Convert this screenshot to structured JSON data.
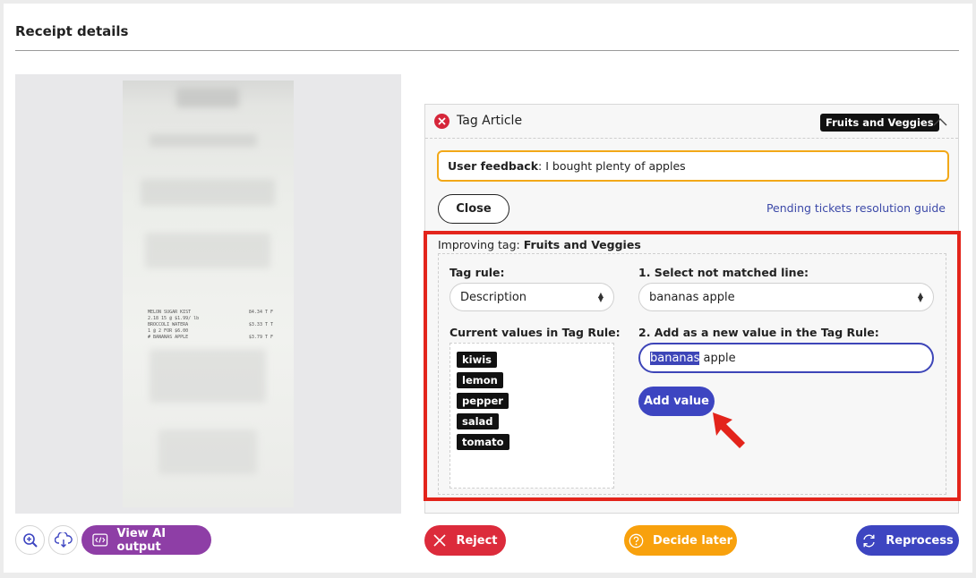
{
  "header": {
    "title": "Receipt details"
  },
  "receipt": {
    "lines": [
      [
        "MELON SUGAR KIST",
        "84.34 T F"
      ],
      [
        "2.18 15 @ $1.99/ lb",
        ""
      ],
      [
        "BROCCOLI WATERA",
        "$3.33 T T"
      ],
      [
        "1 @ 2 FOR $6.00",
        ""
      ],
      [
        "# BANANAS APPLE",
        "$3.79 T F"
      ]
    ]
  },
  "left_controls": {
    "zoom_icon": "zoom-in-icon",
    "download_icon": "cloud-download-icon",
    "ai_button_label": "View AI output"
  },
  "tag_panel": {
    "title": "Tag Article",
    "status_icon": "error-circle-icon",
    "badge": "Fruits and Veggies",
    "feedback_label": "User feedback",
    "feedback_text": ": I bought plenty of apples",
    "close_label": "Close",
    "guide_link": "Pending tickets resolution guide",
    "improving_label": "Improving tag: ",
    "improving_tag": "Fruits and Veggies",
    "tag_rule_label": "Tag rule:",
    "tag_rule_value": "Description",
    "current_values_label": "Current values in Tag Rule:",
    "current_values": [
      "kiwis",
      "lemon",
      "pepper",
      "salad",
      "tomato"
    ],
    "step1_label": "1. Select not matched line:",
    "step1_value": "bananas apple",
    "step2_label": "2. Add as a new value in the Tag Rule:",
    "step2_selected": "bananas",
    "step2_rest": " apple",
    "add_button": "Add value"
  },
  "actions": {
    "reject": "Reject",
    "decide_later": "Decide later",
    "reprocess": "Reprocess"
  },
  "colors": {
    "primary": "#3d45c1",
    "danger": "#dc2b3b",
    "warning": "#f8a10d",
    "purple": "#8e3ea6",
    "highlight": "#e3241b"
  }
}
